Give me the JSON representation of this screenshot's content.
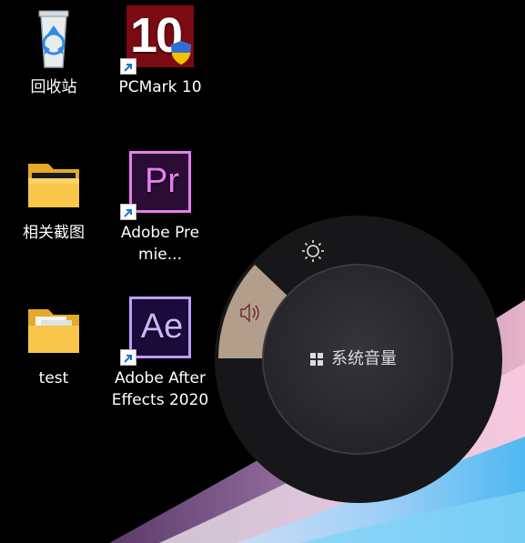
{
  "desktop": {
    "icons": [
      {
        "label": "回收站",
        "icon": "recycle-bin-icon"
      },
      {
        "label": "PCMark 10",
        "icon": "pcmark-icon",
        "glyph": "10",
        "shortcut": true
      },
      {
        "label": "相关截图",
        "icon": "folder-icon"
      },
      {
        "label": "Adobe Premie...",
        "icon": "adobe-premiere-icon",
        "glyph": "Pr",
        "shortcut": true
      },
      {
        "label": "test",
        "icon": "folder-icon"
      },
      {
        "label": "Adobe After Effects 2020",
        "icon": "adobe-after-effects-icon",
        "glyph": "Ae",
        "shortcut": true
      }
    ]
  },
  "dial": {
    "segments": [
      {
        "name": "brightness",
        "icon": "brightness-icon",
        "selected": false
      },
      {
        "name": "volume",
        "icon": "speaker-icon",
        "selected": true
      }
    ],
    "center_label": "系统音量",
    "center_icon": "windows-icon",
    "colors": {
      "selected_segment": "#b19f8c",
      "ring": "#1a1a1c",
      "center": "#28282c"
    }
  }
}
